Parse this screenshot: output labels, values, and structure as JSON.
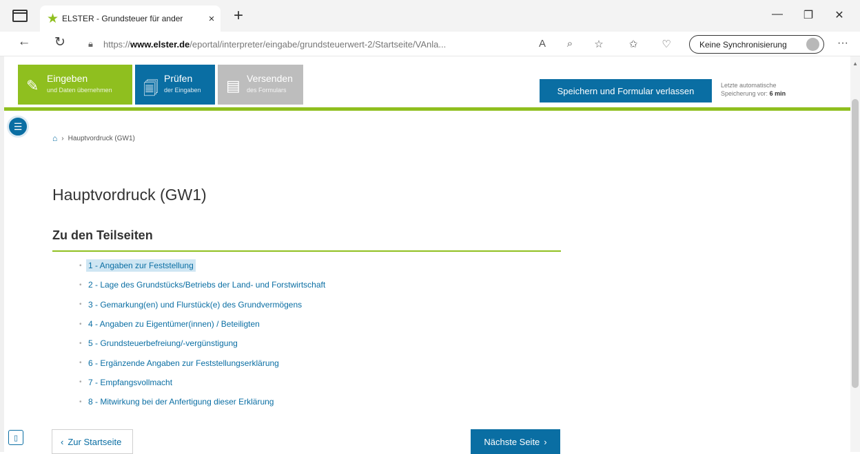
{
  "browser": {
    "tab_title": "ELSTER - Grundsteuer für ander",
    "tab_close": "×",
    "new_tab": "+",
    "url_prefix": "https://",
    "url_host": "www.elster.de",
    "url_path": "/eportal/interpreter/eingabe/grundsteuerwert-2/Startseite/VAnla...",
    "sync_label": "Keine Synchronisierung",
    "window_controls": [
      "—",
      "❐",
      "✕"
    ]
  },
  "steps": [
    {
      "title": "Eingeben",
      "subtitle": "und Daten übernehmen"
    },
    {
      "title": "Prüfen",
      "subtitle": "der Eingaben"
    },
    {
      "title": "Versenden",
      "subtitle": "des Formulars"
    }
  ],
  "toolbar": {
    "save_label": "Speichern und Formular verlassen",
    "autosave_line1": "Letzte automatische",
    "autosave_line2": "Speicherung vor:",
    "autosave_value": "6 min"
  },
  "breadcrumb": {
    "current": "Hauptvordruck (GW1)"
  },
  "page_title": "Hauptvordruck (GW1)",
  "section_title": "Zu den Teilseiten",
  "subpages": [
    "1 - Angaben zur Feststellung",
    "2 - Lage des Grundstücks/Betriebs der Land- und Forstwirtschaft",
    "3 - Gemarkung(en) und Flurstück(e) des Grundvermögens",
    "4 - Angaben zu Eigentümer(innen) / Beteiligten",
    "5 - Grundsteuerbefreiung/-vergünstigung",
    "6 - Ergänzende Angaben zur Feststellungserklärung",
    "7 - Empfangsvollmacht",
    "8 - Mitwirkung bei der Anfertigung dieser Erklärung"
  ],
  "nav": {
    "back_label": "Zur Startseite",
    "next_label": "Nächste Seite"
  },
  "colors": {
    "green": "#8fbf1f",
    "blue": "#0a6ea3",
    "grey": "#bdbdbd"
  }
}
